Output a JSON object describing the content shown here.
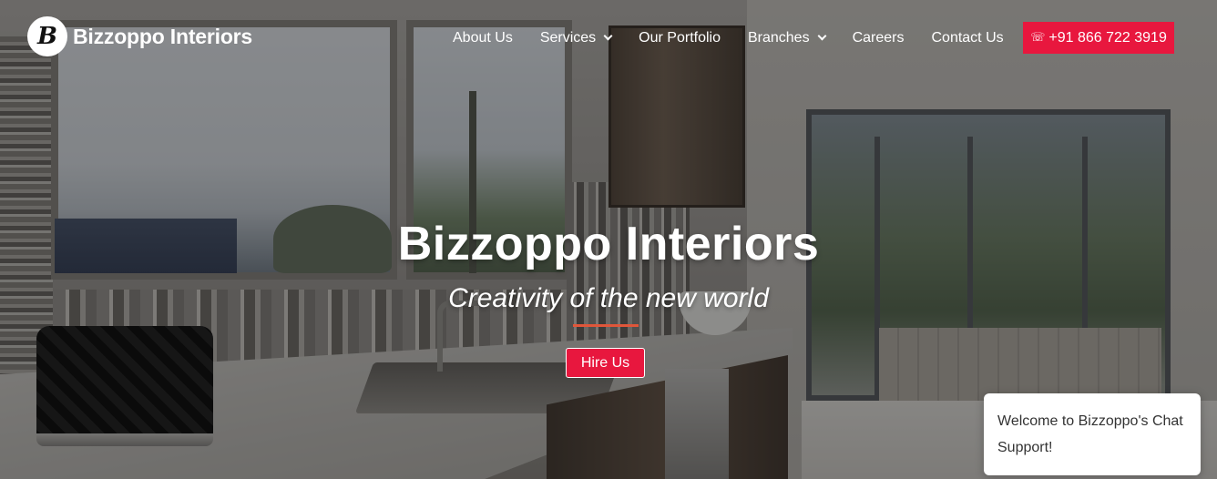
{
  "brand": {
    "logo_initial": "B",
    "name": "Bizzoppo Interiors"
  },
  "nav": {
    "items": [
      {
        "label": "About Us",
        "has_dropdown": false
      },
      {
        "label": "Services",
        "has_dropdown": true
      },
      {
        "label": "Our Portfolio",
        "has_dropdown": false
      },
      {
        "label": "Branches",
        "has_dropdown": true
      },
      {
        "label": "Careers",
        "has_dropdown": false
      },
      {
        "label": "Contact Us",
        "has_dropdown": false
      }
    ],
    "phone_icon": "phone-icon",
    "phone_label": "+91 866 722 3919"
  },
  "hero": {
    "title": "Bizzoppo Interiors",
    "subtitle": "Creativity of the new world",
    "cta_label": "Hire Us"
  },
  "chat": {
    "message": "Welcome to Bizzoppo's Chat Support!"
  },
  "colors": {
    "accent": "#e8173e",
    "divider": "#e0563a",
    "text_light": "#ffffff"
  }
}
